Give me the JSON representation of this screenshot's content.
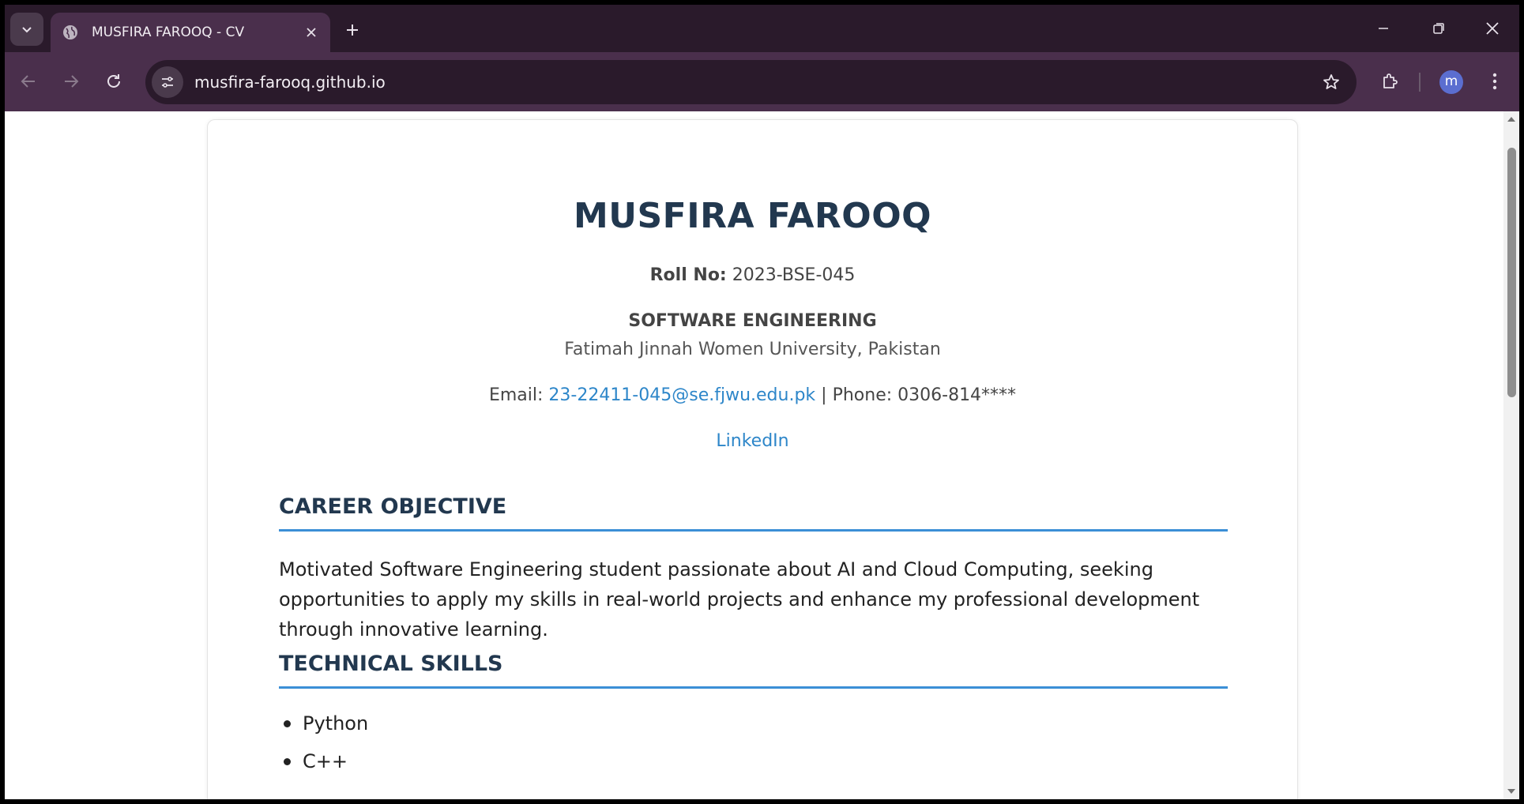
{
  "browser": {
    "tab": {
      "title": "MUSFIRA FAROOQ - CV"
    },
    "url": "musfira-farooq.github.io",
    "profile_initial": "m"
  },
  "cv": {
    "name": "MUSFIRA FAROOQ",
    "roll_label": "Roll No:",
    "roll_value": "2023-BSE-045",
    "department": "SOFTWARE ENGINEERING",
    "university": "Fatimah Jinnah Women University, Pakistan",
    "email_label": "Email:",
    "email": "23-22411-045@se.fjwu.edu.pk",
    "phone_sep": "| Phone:",
    "phone": "0306-814****",
    "linkedin": "LinkedIn",
    "sections": {
      "objective_title": "CAREER OBJECTIVE",
      "objective_text": "Motivated Software Engineering student passionate about AI and Cloud Computing, seeking opportunities to apply my skills in real-world projects and enhance my professional development through innovative learning.",
      "skills_title": "TECHNICAL SKILLS",
      "skills": [
        "Python",
        "C++"
      ]
    }
  },
  "colors": {
    "accent": "#3b8fd6",
    "link": "#2d86c9",
    "heading": "#22384f",
    "frame": "#4a2f4c"
  }
}
